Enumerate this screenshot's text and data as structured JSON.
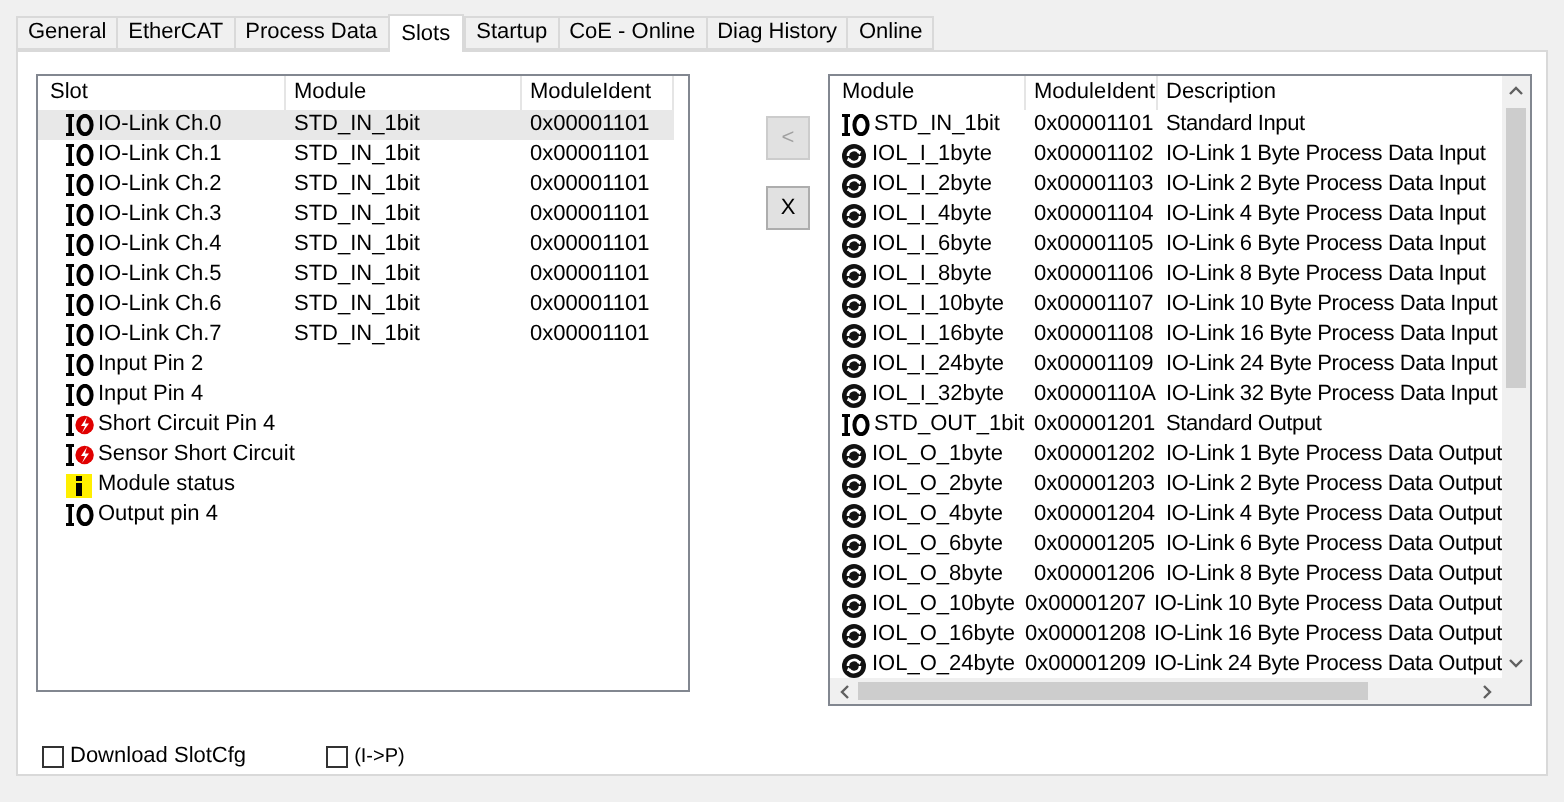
{
  "tabs": [
    {
      "label": "General",
      "selected": false
    },
    {
      "label": "EtherCAT",
      "selected": false
    },
    {
      "label": "Process Data",
      "selected": false
    },
    {
      "label": "Slots",
      "selected": true
    },
    {
      "label": "Startup",
      "selected": false
    },
    {
      "label": "CoE - Online",
      "selected": false
    },
    {
      "label": "Diag History",
      "selected": false
    },
    {
      "label": "Online",
      "selected": false
    }
  ],
  "slots": {
    "columns": [
      "Slot",
      "Module",
      "ModuleIdent"
    ],
    "rows": [
      {
        "kind": "io",
        "slot": "IO-Link Ch.0",
        "module": "STD_IN_1bit",
        "ident": "0x00001101",
        "selected": true
      },
      {
        "kind": "io",
        "slot": "IO-Link Ch.1",
        "module": "STD_IN_1bit",
        "ident": "0x00001101",
        "selected": false
      },
      {
        "kind": "io",
        "slot": "IO-Link Ch.2",
        "module": "STD_IN_1bit",
        "ident": "0x00001101",
        "selected": false
      },
      {
        "kind": "io",
        "slot": "IO-Link Ch.3",
        "module": "STD_IN_1bit",
        "ident": "0x00001101",
        "selected": false
      },
      {
        "kind": "io",
        "slot": "IO-Link Ch.4",
        "module": "STD_IN_1bit",
        "ident": "0x00001101",
        "selected": false
      },
      {
        "kind": "io",
        "slot": "IO-Link Ch.5",
        "module": "STD_IN_1bit",
        "ident": "0x00001101",
        "selected": false
      },
      {
        "kind": "io",
        "slot": "IO-Link Ch.6",
        "module": "STD_IN_1bit",
        "ident": "0x00001101",
        "selected": false
      },
      {
        "kind": "io",
        "slot": "IO-Link Ch.7",
        "module": "STD_IN_1bit",
        "ident": "0x00001101",
        "selected": false
      },
      {
        "kind": "io",
        "slot": "Input Pin 2",
        "selected": false
      },
      {
        "kind": "io",
        "slot": "Input Pin 4",
        "selected": false
      },
      {
        "kind": "fault",
        "slot": "Short Circuit Pin 4",
        "selected": false
      },
      {
        "kind": "fault",
        "slot": "Sensor Short Circuit",
        "selected": false
      },
      {
        "kind": "info",
        "slot": "Module status",
        "selected": false
      },
      {
        "kind": "io",
        "slot": "Output pin 4",
        "selected": false
      }
    ]
  },
  "buttons": [
    {
      "label": "<",
      "disabled": true
    },
    {
      "label": "X",
      "disabled": false
    }
  ],
  "modules": {
    "columns": [
      "Module",
      "ModuleIdent",
      "Description"
    ],
    "rows": [
      {
        "kind": "io",
        "module": "STD_IN_1bit",
        "ident": "0x00001101",
        "description": "Standard Input"
      },
      {
        "kind": "iol",
        "module": "IOL_I_1byte",
        "ident": "0x00001102",
        "description": "IO-Link 1 Byte Process Data Input"
      },
      {
        "kind": "iol",
        "module": "IOL_I_2byte",
        "ident": "0x00001103",
        "description": "IO-Link 2 Byte Process Data Input"
      },
      {
        "kind": "iol",
        "module": "IOL_I_4byte",
        "ident": "0x00001104",
        "description": "IO-Link 4 Byte Process Data Input"
      },
      {
        "kind": "iol",
        "module": "IOL_I_6byte",
        "ident": "0x00001105",
        "description": "IO-Link 6 Byte Process Data Input"
      },
      {
        "kind": "iol",
        "module": "IOL_I_8byte",
        "ident": "0x00001106",
        "description": "IO-Link 8 Byte Process Data Input"
      },
      {
        "kind": "iol",
        "module": "IOL_I_10byte",
        "ident": "0x00001107",
        "description": "IO-Link 10 Byte Process Data Input"
      },
      {
        "kind": "iol",
        "module": "IOL_I_16byte",
        "ident": "0x00001108",
        "description": "IO-Link 16 Byte Process Data Input"
      },
      {
        "kind": "iol",
        "module": "IOL_I_24byte",
        "ident": "0x00001109",
        "description": "IO-Link 24 Byte Process Data Input"
      },
      {
        "kind": "iol",
        "module": "IOL_I_32byte",
        "ident": "0x0000110A",
        "description": "IO-Link 32 Byte Process Data Input"
      },
      {
        "kind": "io",
        "module": "STD_OUT_1bit",
        "ident": "0x00001201",
        "description": "Standard Output"
      },
      {
        "kind": "iol",
        "module": "IOL_O_1byte",
        "ident": "0x00001202",
        "description": "IO-Link 1 Byte Process Data Output"
      },
      {
        "kind": "iol",
        "module": "IOL_O_2byte",
        "ident": "0x00001203",
        "description": "IO-Link 2 Byte Process Data Output"
      },
      {
        "kind": "iol",
        "module": "IOL_O_4byte",
        "ident": "0x00001204",
        "description": "IO-Link 4 Byte Process Data Output"
      },
      {
        "kind": "iol",
        "module": "IOL_O_6byte",
        "ident": "0x00001205",
        "description": "IO-Link 6 Byte Process Data Output"
      },
      {
        "kind": "iol",
        "module": "IOL_O_8byte",
        "ident": "0x00001206",
        "description": "IO-Link 8 Byte Process Data Output"
      },
      {
        "kind": "iol",
        "module": "IOL_O_10byte",
        "ident": "0x00001207",
        "description": "IO-Link 10 Byte Process Data Output"
      },
      {
        "kind": "iol",
        "module": "IOL_O_16byte",
        "ident": "0x00001208",
        "description": "IO-Link 16 Byte Process Data Output"
      },
      {
        "kind": "iol",
        "module": "IOL_O_24byte",
        "ident": "0x00001209",
        "description": "IO-Link 24 Byte Process Data Output"
      }
    ]
  },
  "options": [
    {
      "label": "Download SlotCfg",
      "checked": false
    },
    {
      "label": "(I->P)",
      "checked": false
    }
  ]
}
